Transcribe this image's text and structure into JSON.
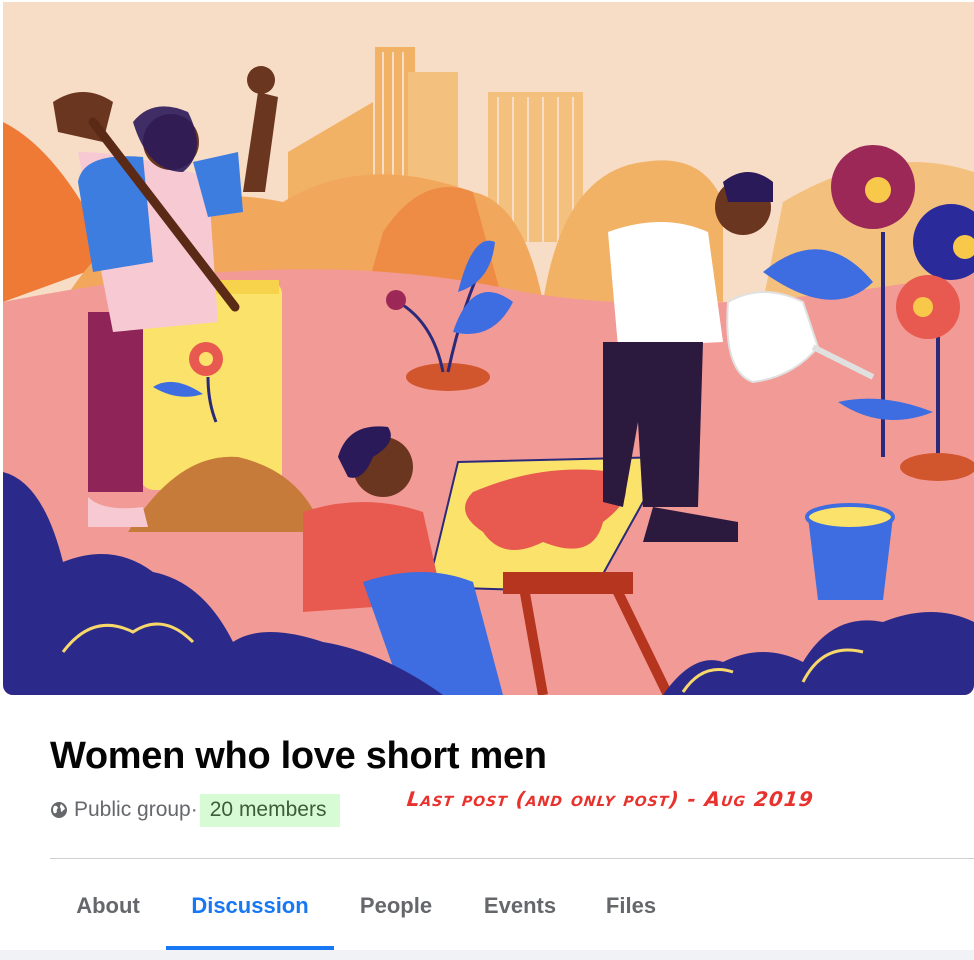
{
  "group": {
    "name": "Women who love short men",
    "privacy": "Public group",
    "separator": " · ",
    "members": "20 members"
  },
  "annotation": "Last post (and only post) - Aug 2019",
  "tabs": [
    {
      "label": "About",
      "active": false
    },
    {
      "label": "Discussion",
      "active": true
    },
    {
      "label": "People",
      "active": false
    },
    {
      "label": "Events",
      "active": false
    },
    {
      "label": "Files",
      "active": false
    }
  ],
  "colors": {
    "accent": "#1877f2",
    "members_highlight": "#d7fbd5",
    "annotation": "#e8322e"
  },
  "icons": {
    "privacy": "globe-icon"
  }
}
